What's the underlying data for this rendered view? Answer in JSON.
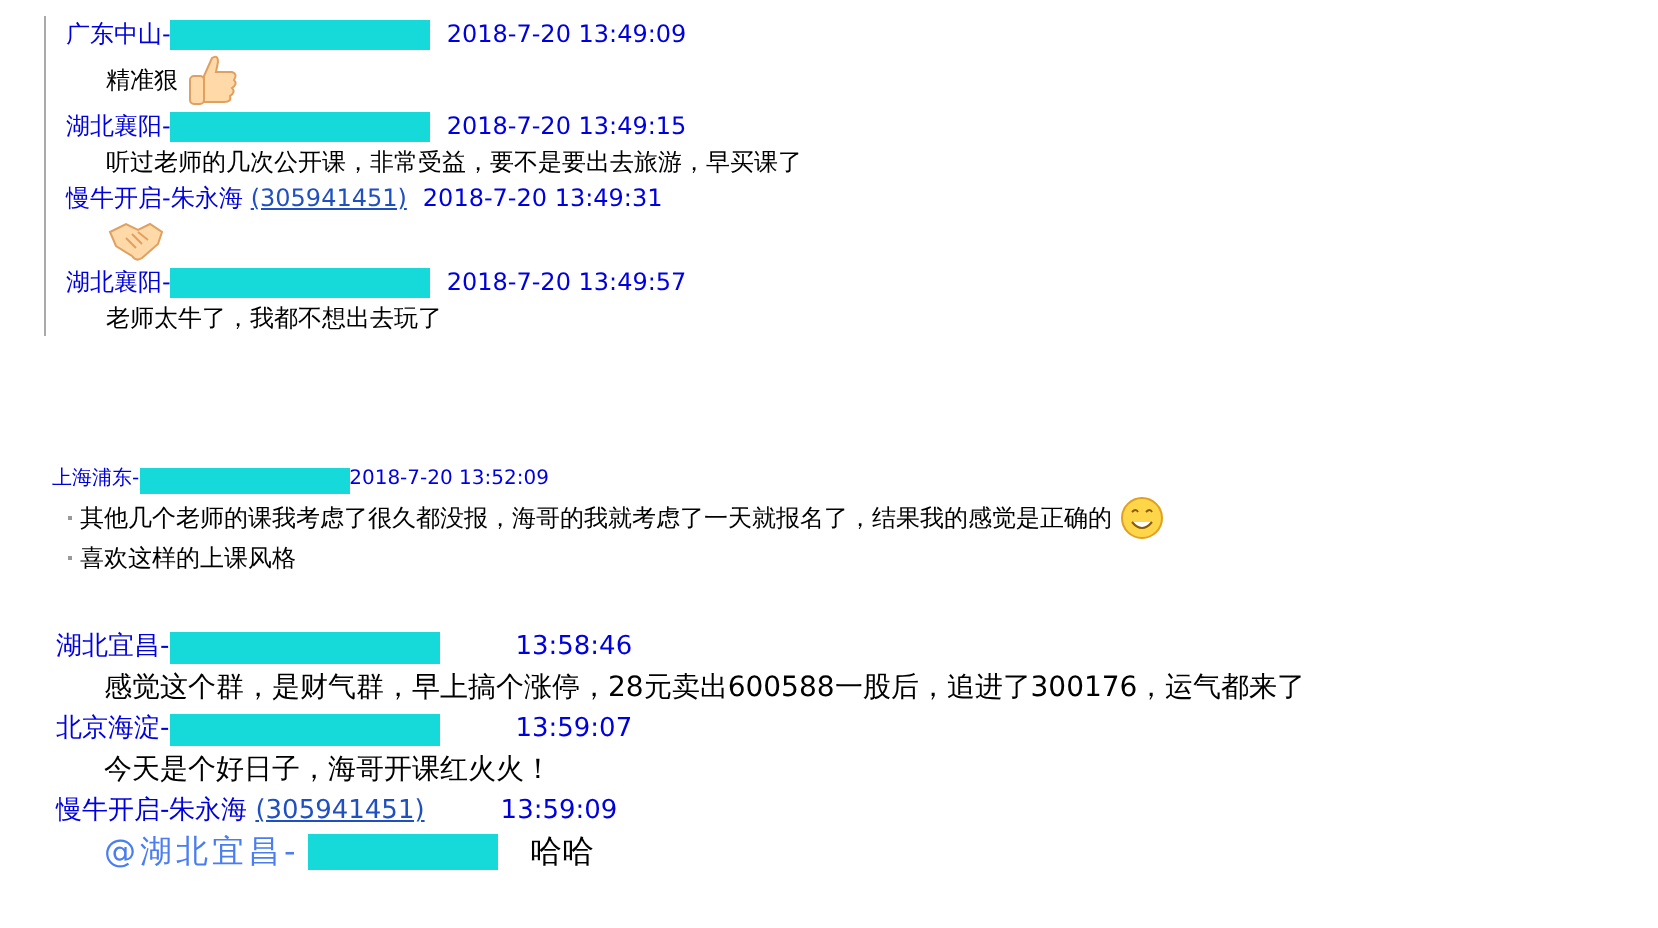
{
  "sections": [
    {
      "kind": "bordered",
      "messages": [
        {
          "sender": "广东中山-",
          "redacted": true,
          "time": "2018-7-20 13:49:09",
          "lines": [
            {
              "text": "精准狠",
              "kind": "thumbs-up"
            }
          ]
        },
        {
          "sender": "湖北襄阳-",
          "redacted": true,
          "time": "2018-7-20 13:49:15",
          "lines": [
            {
              "text": "听过老师的几次公开课，非常受益，要不是要出去旅游，早买课了"
            }
          ]
        },
        {
          "sender": "慢牛开启-朱永海",
          "redacted": false,
          "qq": "(305941451)",
          "time": "2018-7-20 13:49:31",
          "lines": [
            {
              "kind": "handshake"
            }
          ]
        },
        {
          "sender": "湖北襄阳-",
          "redacted": true,
          "time": "2018-7-20 13:49:57",
          "lines": [
            {
              "text": "老师太牛了，我都不想出去玩了"
            }
          ]
        }
      ]
    },
    {
      "kind": "small",
      "messages": [
        {
          "sender": "上海浦东-",
          "redacted": true,
          "time": "2018-7-20 13:52:09",
          "lines": [
            {
              "text": "其他几个老师的课我考虑了很久都没报，海哥的我就考虑了一天就报名了，结果我的感觉是正确的",
              "kind": "grin"
            },
            {
              "text": "喜欢这样的上课风格"
            }
          ]
        }
      ]
    },
    {
      "kind": "large",
      "messages": [
        {
          "sender": "湖北宜昌-",
          "redacted": true,
          "time": "13:58:46",
          "lines": [
            {
              "text": "感觉这个群，是财气群，早上搞个涨停，28元卖出600588一股后，追进了300176，运气都来了"
            }
          ]
        },
        {
          "sender": "北京海淀-",
          "redacted": true,
          "time": "13:59:07",
          "lines": [
            {
              "text": "今天是个好日子，海哥开课红火火！"
            }
          ]
        },
        {
          "sender": "慢牛开启-朱永海",
          "redacted": false,
          "qq": "(305941451)",
          "time": "13:59:09",
          "lines": [
            {
              "mention": "@湖北宜昌-",
              "text": "哈哈"
            }
          ]
        }
      ]
    }
  ]
}
